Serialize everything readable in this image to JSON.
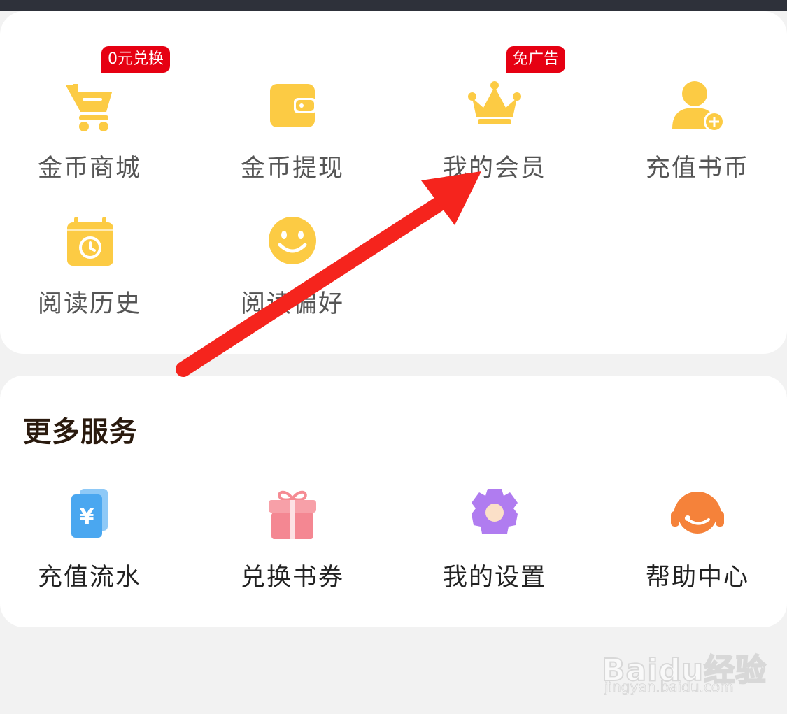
{
  "grid_top": [
    {
      "label": "金币商城",
      "icon": "shopping-cart-icon",
      "badge": "0元兑换"
    },
    {
      "label": "金币提现",
      "icon": "wallet-icon",
      "badge": null
    },
    {
      "label": "我的会员",
      "icon": "crown-icon",
      "badge": "免广告"
    },
    {
      "label": "充值书币",
      "icon": "user-add-icon",
      "badge": null
    },
    {
      "label": "阅读历史",
      "icon": "calendar-history-icon",
      "badge": null
    },
    {
      "label": "阅读偏好",
      "icon": "smiley-icon",
      "badge": null
    }
  ],
  "more_services": {
    "title": "更多服务",
    "items": [
      {
        "label": "充值流水",
        "icon": "yuan-card-icon"
      },
      {
        "label": "兑换书券",
        "icon": "gift-box-icon"
      },
      {
        "label": "我的设置",
        "icon": "gear-icon"
      },
      {
        "label": "帮助中心",
        "icon": "headset-icon"
      }
    ]
  },
  "watermark": {
    "brand": "Baidu经验",
    "url": "jingyan.baidu.com"
  },
  "colors": {
    "icon_yellow": "#fccb44",
    "badge_red": "#e60012",
    "arrow_red": "#f5241d",
    "background": "#f2f2f2"
  }
}
